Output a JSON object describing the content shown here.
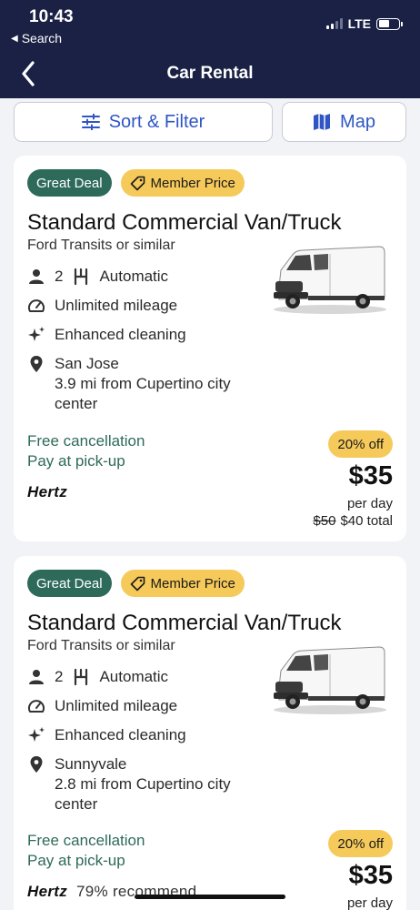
{
  "status_bar": {
    "time": "10:43",
    "back_app": "Search",
    "network": "LTE"
  },
  "nav": {
    "title": "Car Rental"
  },
  "toolbar": {
    "sort_filter_label": "Sort & Filter",
    "map_label": "Map"
  },
  "listings": [
    {
      "badge_deal": "Great Deal",
      "badge_member": "Member Price",
      "title": "Standard Commercial Van/Truck",
      "subtitle": "Ford Transits or similar",
      "seats": "2",
      "transmission": "Automatic",
      "mileage": "Unlimited mileage",
      "cleaning": "Enhanced cleaning",
      "location_name": "San Jose",
      "location_line2": "3.9 mi from Cupertino city",
      "location_line3": "center",
      "free_cancellation": "Free cancellation",
      "pay_at_pickup": "Pay at pick-up",
      "vendor": "Hertz",
      "discount": "20% off",
      "price": "$35",
      "per_day": "per day",
      "old_total": "$50",
      "total": "$40 total"
    },
    {
      "badge_deal": "Great Deal",
      "badge_member": "Member Price",
      "title": "Standard Commercial Van/Truck",
      "subtitle": "Ford Transits or similar",
      "seats": "2",
      "transmission": "Automatic",
      "mileage": "Unlimited mileage",
      "cleaning": "Enhanced cleaning",
      "location_name": "Sunnyvale",
      "location_line2": "2.8 mi from Cupertino city",
      "location_line3": "center",
      "free_cancellation": "Free cancellation",
      "pay_at_pickup": "Pay at pick-up",
      "vendor": "Hertz",
      "recommend": "79% recommend",
      "discount": "20% off",
      "price": "$35",
      "per_day": "per day"
    }
  ],
  "colors": {
    "header_bg": "#1a2144",
    "accent_blue": "#2f56c4",
    "deal_green": "#2e6a5a",
    "member_yellow": "#f6ca5a"
  },
  "icons": [
    "back-chevron-icon",
    "sliders-icon",
    "map-icon",
    "tag-icon",
    "person-icon",
    "gearshift-icon",
    "speedometer-icon",
    "sparkle-icon",
    "location-pin-icon"
  ]
}
